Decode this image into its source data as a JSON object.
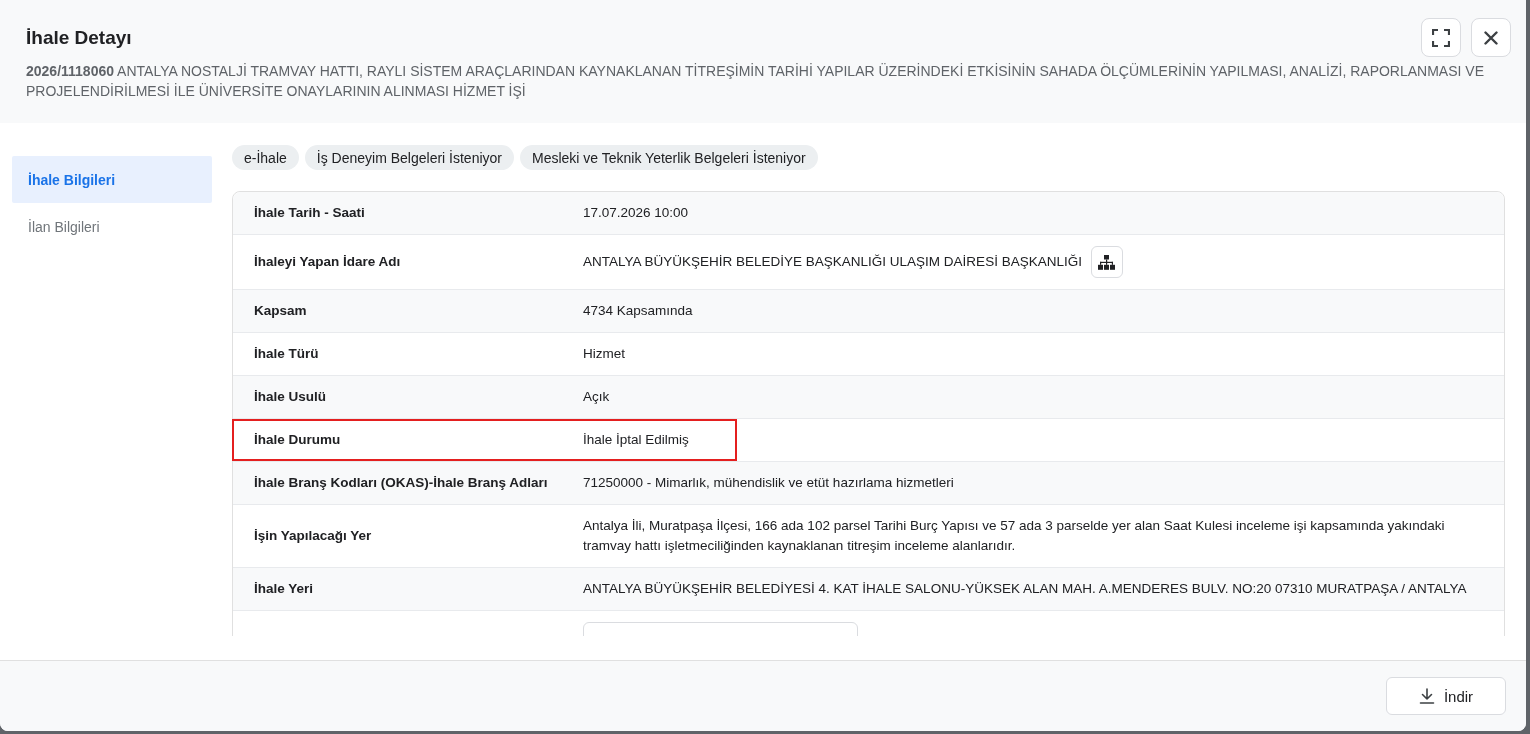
{
  "dialog": {
    "title": "İhale Detayı",
    "subtitle": "**2026/1118060** ANTALYA NOSTALJİ TRAMVAY HATTI, RAYLI SİSTEM ARAÇLARINDAN KAYNAKLANAN TİTREŞİMİN TARİHİ YAPILAR ÜZERİNDEKİ ETKİSİNİN SAHADA ÖLÇÜMLERİNİN YAPILMASI, ANALİZİ, RAPORLANMASI VE PROJELENDİRİLMESİ İLE ÜNİVERSİTE ONAYLARININ ALINMASI HİZMET İŞİ",
    "actions": [
      {
        "kind": "fullscreen"
      },
      {
        "kind": "close"
      }
    ]
  },
  "sidebar": {
    "items": [
      {
        "label": "İhale Bilgileri",
        "selected": true
      },
      {
        "label": "İlan Bilgileri",
        "selected": false
      }
    ]
  },
  "tags": [
    "e-İhale",
    "İş Deneyim Belgeleri İsteniyor",
    "Mesleki ve Teknik Yeterlik Belgeleri İsteniyor"
  ],
  "details": {
    "rows": [
      {
        "kind": "text",
        "label": "İhale Tarih - Saati",
        "value": "17.07.2026 10:00",
        "highlighted": false
      },
      {
        "kind": "org",
        "label": "İhaleyi Yapan İdare Adı",
        "value": "ANTALYA BÜYÜKŞEHİR BELEDİYE BAŞKANLIĞI ULAŞIM DAİRESİ BAŞKANLIĞI",
        "highlighted": false
      },
      {
        "kind": "text",
        "label": "Kapsam",
        "value": "4734 Kapsamında",
        "highlighted": false
      },
      {
        "kind": "text",
        "label": "İhale Türü",
        "value": "Hizmet",
        "highlighted": false
      },
      {
        "kind": "text",
        "label": "İhale Usulü",
        "value": "Açık",
        "highlighted": false
      },
      {
        "kind": "text",
        "label": "İhale Durumu",
        "value": "İhale İptal Edilmiş",
        "highlighted": true
      },
      {
        "kind": "text",
        "label": "İhale Branş Kodları (OKAS)-İhale Branş Adları",
        "value": "71250000 - Mimarlık, mühendislik ve etüt hazırlama hizmetleri",
        "highlighted": false
      },
      {
        "kind": "text",
        "label": "İşin Yapılacağı Yer",
        "value": "Antalya İli, Muratpaşa İlçesi, 166 ada 102 parsel Tarihi Burç Yapısı ve 57 ada 3 parselde yer alan Saat Kulesi inceleme işi kapsamında yakındaki tramvay hattı işletmeciliğinden kaynaklanan titreşim inceleme alanlarıdır.",
        "highlighted": false
      },
      {
        "kind": "text",
        "label": "İhale Yeri",
        "value": "ANTALYA BÜYÜKŞEHİR BELEDİYESİ 4. KAT İHALE SALONU-YÜKSEK ALAN MAH. A.MENDERES BULV. NO:20 07310 MURATPAŞA / ANTALYA",
        "highlighted": false
      },
      {
        "kind": "button",
        "highlighted": false
      }
    ]
  },
  "footer": {
    "buttons": [
      {
        "kind": "download",
        "label": "İndir"
      }
    ]
  }
}
